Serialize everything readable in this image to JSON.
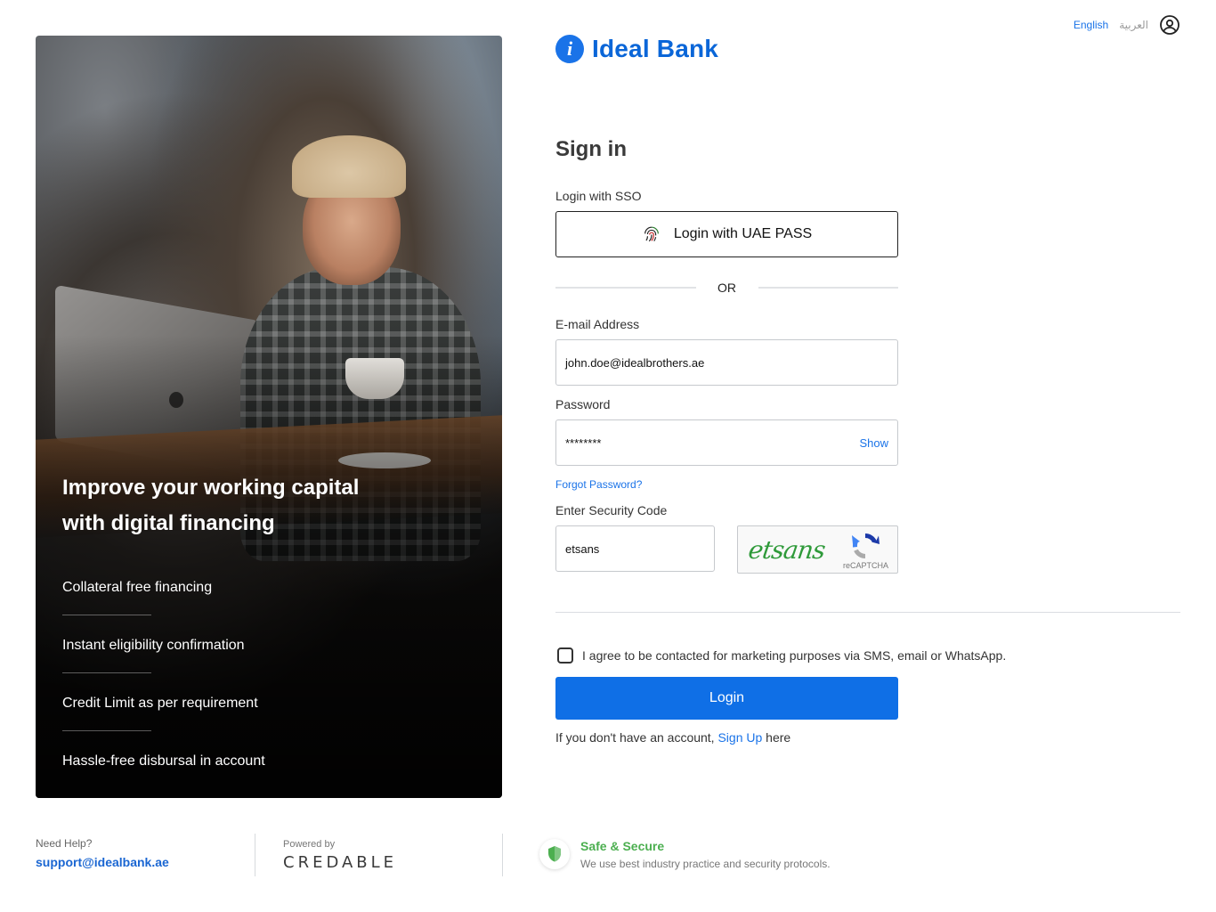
{
  "header": {
    "lang_en": "English",
    "lang_ar": "العربية",
    "user_icon": "user-circle-icon"
  },
  "brand": {
    "logo_mark": "i",
    "name": "Ideal Bank",
    "color": "#0a66d8"
  },
  "hero": {
    "title": "Improve your working capital with digital financing",
    "features": [
      "Collateral free financing",
      "Instant eligibility confirmation",
      "Credit Limit as per requirement",
      "Hassle-free disbursal in account"
    ]
  },
  "signin": {
    "title": "Sign in",
    "sso_label": "Login with SSO",
    "uae_pass_button": "Login with UAE PASS",
    "or_text": "OR",
    "email_label": "E-mail Address",
    "email_value": "john.doe@idealbrothers.ae",
    "password_label": "Password",
    "password_value": "********",
    "show_label": "Show",
    "forgot_label": "Forgot Password?",
    "security_label": "Enter Security Code",
    "security_value": "etsans",
    "captcha_word": "etsans",
    "recaptcha_text": "reCAPTCHA",
    "consent_text": "I agree to be contacted for marketing purposes via SMS, email or WhatsApp.",
    "consent_checked": false,
    "login_button": "Login",
    "signup_prefix": "If you don't have an account, ",
    "signup_link": "Sign Up",
    "signup_suffix": " here",
    "accent_color": "#0f6fe6"
  },
  "footer": {
    "help_label": "Need Help?",
    "help_email": "support@idealbank.ae",
    "powered_label": "Powered by",
    "powered_brand": "CREDABLE",
    "secure_title": "Safe & Secure",
    "secure_desc": "We use best industry practice and security protocols.",
    "secure_color": "#4caf50"
  }
}
